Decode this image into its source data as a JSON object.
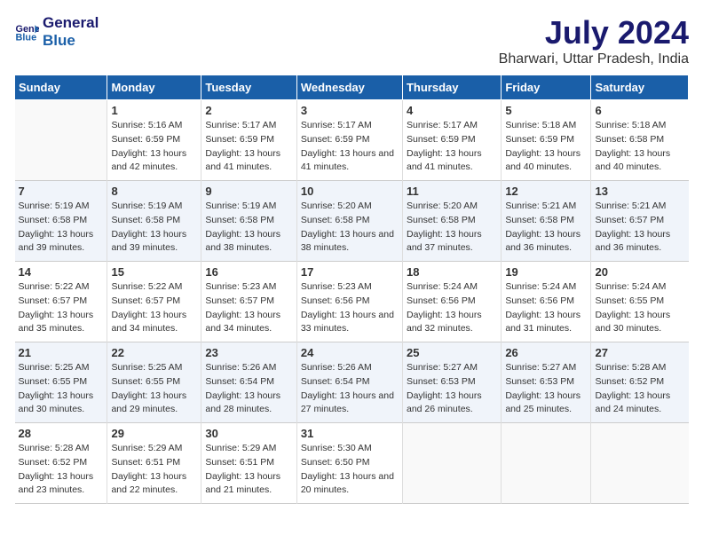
{
  "header": {
    "logo_line1": "General",
    "logo_line2": "Blue",
    "title": "July 2024",
    "subtitle": "Bharwari, Uttar Pradesh, India"
  },
  "weekdays": [
    "Sunday",
    "Monday",
    "Tuesday",
    "Wednesday",
    "Thursday",
    "Friday",
    "Saturday"
  ],
  "weeks": [
    [
      {
        "day": "",
        "sunrise": "",
        "sunset": "",
        "daylight": ""
      },
      {
        "day": "1",
        "sunrise": "Sunrise: 5:16 AM",
        "sunset": "Sunset: 6:59 PM",
        "daylight": "Daylight: 13 hours and 42 minutes."
      },
      {
        "day": "2",
        "sunrise": "Sunrise: 5:17 AM",
        "sunset": "Sunset: 6:59 PM",
        "daylight": "Daylight: 13 hours and 41 minutes."
      },
      {
        "day": "3",
        "sunrise": "Sunrise: 5:17 AM",
        "sunset": "Sunset: 6:59 PM",
        "daylight": "Daylight: 13 hours and 41 minutes."
      },
      {
        "day": "4",
        "sunrise": "Sunrise: 5:17 AM",
        "sunset": "Sunset: 6:59 PM",
        "daylight": "Daylight: 13 hours and 41 minutes."
      },
      {
        "day": "5",
        "sunrise": "Sunrise: 5:18 AM",
        "sunset": "Sunset: 6:59 PM",
        "daylight": "Daylight: 13 hours and 40 minutes."
      },
      {
        "day": "6",
        "sunrise": "Sunrise: 5:18 AM",
        "sunset": "Sunset: 6:58 PM",
        "daylight": "Daylight: 13 hours and 40 minutes."
      }
    ],
    [
      {
        "day": "7",
        "sunrise": "Sunrise: 5:19 AM",
        "sunset": "Sunset: 6:58 PM",
        "daylight": "Daylight: 13 hours and 39 minutes."
      },
      {
        "day": "8",
        "sunrise": "Sunrise: 5:19 AM",
        "sunset": "Sunset: 6:58 PM",
        "daylight": "Daylight: 13 hours and 39 minutes."
      },
      {
        "day": "9",
        "sunrise": "Sunrise: 5:19 AM",
        "sunset": "Sunset: 6:58 PM",
        "daylight": "Daylight: 13 hours and 38 minutes."
      },
      {
        "day": "10",
        "sunrise": "Sunrise: 5:20 AM",
        "sunset": "Sunset: 6:58 PM",
        "daylight": "Daylight: 13 hours and 38 minutes."
      },
      {
        "day": "11",
        "sunrise": "Sunrise: 5:20 AM",
        "sunset": "Sunset: 6:58 PM",
        "daylight": "Daylight: 13 hours and 37 minutes."
      },
      {
        "day": "12",
        "sunrise": "Sunrise: 5:21 AM",
        "sunset": "Sunset: 6:58 PM",
        "daylight": "Daylight: 13 hours and 36 minutes."
      },
      {
        "day": "13",
        "sunrise": "Sunrise: 5:21 AM",
        "sunset": "Sunset: 6:57 PM",
        "daylight": "Daylight: 13 hours and 36 minutes."
      }
    ],
    [
      {
        "day": "14",
        "sunrise": "Sunrise: 5:22 AM",
        "sunset": "Sunset: 6:57 PM",
        "daylight": "Daylight: 13 hours and 35 minutes."
      },
      {
        "day": "15",
        "sunrise": "Sunrise: 5:22 AM",
        "sunset": "Sunset: 6:57 PM",
        "daylight": "Daylight: 13 hours and 34 minutes."
      },
      {
        "day": "16",
        "sunrise": "Sunrise: 5:23 AM",
        "sunset": "Sunset: 6:57 PM",
        "daylight": "Daylight: 13 hours and 34 minutes."
      },
      {
        "day": "17",
        "sunrise": "Sunrise: 5:23 AM",
        "sunset": "Sunset: 6:56 PM",
        "daylight": "Daylight: 13 hours and 33 minutes."
      },
      {
        "day": "18",
        "sunrise": "Sunrise: 5:24 AM",
        "sunset": "Sunset: 6:56 PM",
        "daylight": "Daylight: 13 hours and 32 minutes."
      },
      {
        "day": "19",
        "sunrise": "Sunrise: 5:24 AM",
        "sunset": "Sunset: 6:56 PM",
        "daylight": "Daylight: 13 hours and 31 minutes."
      },
      {
        "day": "20",
        "sunrise": "Sunrise: 5:24 AM",
        "sunset": "Sunset: 6:55 PM",
        "daylight": "Daylight: 13 hours and 30 minutes."
      }
    ],
    [
      {
        "day": "21",
        "sunrise": "Sunrise: 5:25 AM",
        "sunset": "Sunset: 6:55 PM",
        "daylight": "Daylight: 13 hours and 30 minutes."
      },
      {
        "day": "22",
        "sunrise": "Sunrise: 5:25 AM",
        "sunset": "Sunset: 6:55 PM",
        "daylight": "Daylight: 13 hours and 29 minutes."
      },
      {
        "day": "23",
        "sunrise": "Sunrise: 5:26 AM",
        "sunset": "Sunset: 6:54 PM",
        "daylight": "Daylight: 13 hours and 28 minutes."
      },
      {
        "day": "24",
        "sunrise": "Sunrise: 5:26 AM",
        "sunset": "Sunset: 6:54 PM",
        "daylight": "Daylight: 13 hours and 27 minutes."
      },
      {
        "day": "25",
        "sunrise": "Sunrise: 5:27 AM",
        "sunset": "Sunset: 6:53 PM",
        "daylight": "Daylight: 13 hours and 26 minutes."
      },
      {
        "day": "26",
        "sunrise": "Sunrise: 5:27 AM",
        "sunset": "Sunset: 6:53 PM",
        "daylight": "Daylight: 13 hours and 25 minutes."
      },
      {
        "day": "27",
        "sunrise": "Sunrise: 5:28 AM",
        "sunset": "Sunset: 6:52 PM",
        "daylight": "Daylight: 13 hours and 24 minutes."
      }
    ],
    [
      {
        "day": "28",
        "sunrise": "Sunrise: 5:28 AM",
        "sunset": "Sunset: 6:52 PM",
        "daylight": "Daylight: 13 hours and 23 minutes."
      },
      {
        "day": "29",
        "sunrise": "Sunrise: 5:29 AM",
        "sunset": "Sunset: 6:51 PM",
        "daylight": "Daylight: 13 hours and 22 minutes."
      },
      {
        "day": "30",
        "sunrise": "Sunrise: 5:29 AM",
        "sunset": "Sunset: 6:51 PM",
        "daylight": "Daylight: 13 hours and 21 minutes."
      },
      {
        "day": "31",
        "sunrise": "Sunrise: 5:30 AM",
        "sunset": "Sunset: 6:50 PM",
        "daylight": "Daylight: 13 hours and 20 minutes."
      },
      {
        "day": "",
        "sunrise": "",
        "sunset": "",
        "daylight": ""
      },
      {
        "day": "",
        "sunrise": "",
        "sunset": "",
        "daylight": ""
      },
      {
        "day": "",
        "sunrise": "",
        "sunset": "",
        "daylight": ""
      }
    ]
  ]
}
